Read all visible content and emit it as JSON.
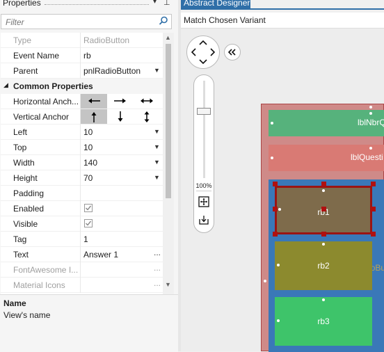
{
  "properties_panel": {
    "title": "Properties",
    "filter_placeholder": "Filter",
    "rows": [
      {
        "name": "Type",
        "value": "RadioButton",
        "dim": true
      },
      {
        "name": "Event Name",
        "value": "rb"
      },
      {
        "name": "Parent",
        "value": "pnlRadioButton",
        "dropdown": true
      }
    ],
    "category": "Common Properties",
    "anchor_rows": [
      {
        "name": "Horizontal Anch..."
      },
      {
        "name": "Vertical Anchor"
      }
    ],
    "rows2": [
      {
        "name": "Left",
        "value": "10"
      },
      {
        "name": "Top",
        "value": "10"
      },
      {
        "name": "Width",
        "value": "140"
      },
      {
        "name": "Height",
        "value": "70"
      },
      {
        "name": "Padding",
        "value": ""
      }
    ],
    "checkbox_rows": [
      {
        "name": "Enabled",
        "checked": true
      },
      {
        "name": "Visible",
        "checked": true
      }
    ],
    "tag": {
      "name": "Tag",
      "value": "1"
    },
    "text": {
      "name": "Text",
      "value": "Answer 1",
      "ellipsis": "..."
    },
    "fontawesome": {
      "name": "FontAwesome I...",
      "ellipsis": "..."
    },
    "material": {
      "name": "Material Icons",
      "ellipsis": "..."
    },
    "description": {
      "name": "Name",
      "text": "View's name"
    }
  },
  "designer": {
    "tab_title": "Abstract Designer",
    "variant": "Match Chosen Variant",
    "zoom": "100%",
    "zoom_level": 0.7,
    "views": {
      "lbl1": "lblNbrQ",
      "lbl2": "lblQuesti",
      "panel_caption": "pnlRadioBu",
      "rb1": "rb1",
      "rb2": "rb2",
      "rb3": "rb3"
    }
  },
  "colors": {
    "accent": "#2f6fa8",
    "selection": "#9b1412",
    "form_bg": "#cf8a88",
    "label1": "#56b27c",
    "label2": "#d97a74",
    "panel": "#3a78b8",
    "rb1": "#7e6b4b",
    "rb2": "#8c8a2e",
    "rb3": "#3ec46a"
  }
}
